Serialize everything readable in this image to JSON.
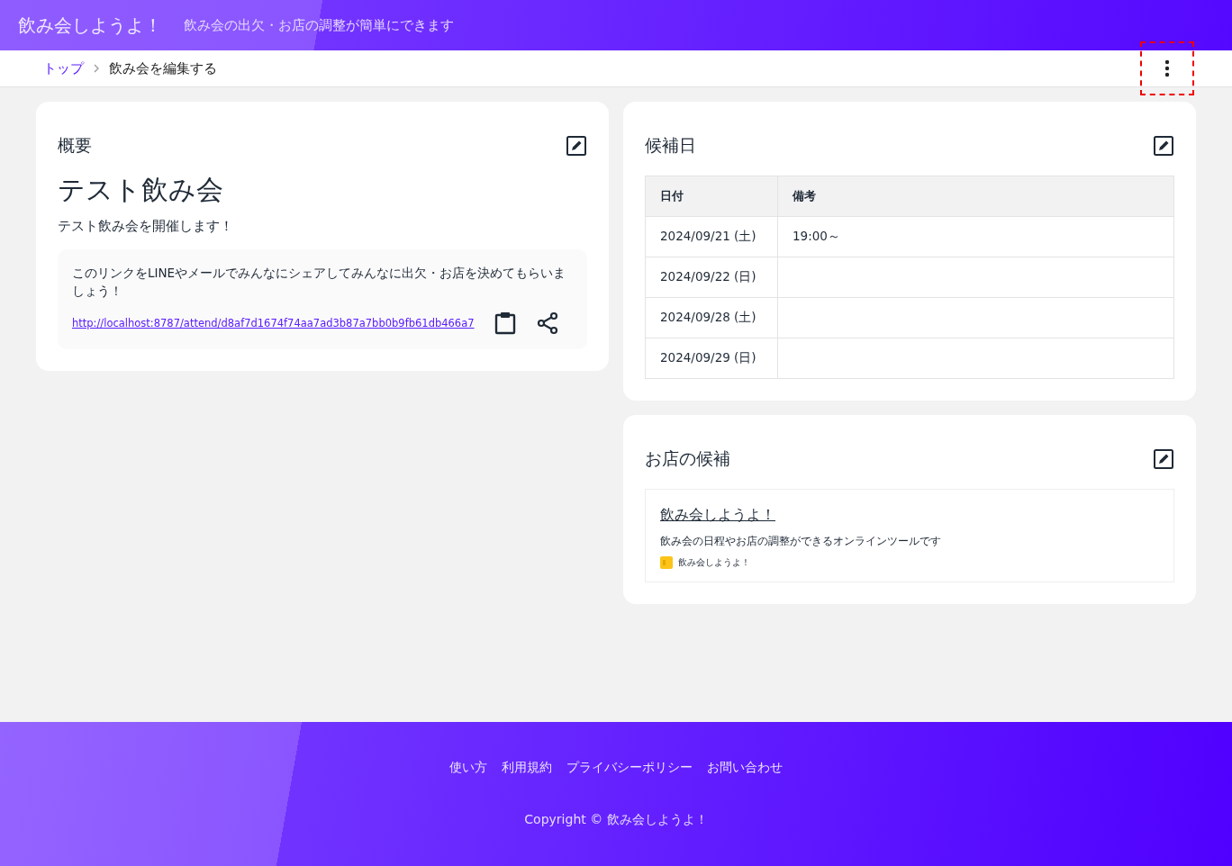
{
  "header": {
    "title": "飲み会しようよ！",
    "tagline": "飲み会の出欠・お店の調整が簡単にできます"
  },
  "breadcrumb": [
    {
      "label": "トップ",
      "link": true
    },
    {
      "label": "飲み会を編集する",
      "link": false
    }
  ],
  "menu_button": {
    "highlighted": true
  },
  "overview": {
    "heading": "概要",
    "event_title": "テスト飲み会",
    "description": "テスト飲み会を開催します！",
    "share_note": "このリンクをLINEやメールでみんなにシェアしてみんなに出欠・お店を決めてもらいましょう！",
    "share_url": "http://localhost:8787/attend/d8af7d1674f74aa7ad3b87a7bb0b9fb61db466a7"
  },
  "candidate_dates": {
    "heading": "候補日",
    "columns": [
      "日付",
      "備考"
    ],
    "rows": [
      {
        "date": "2024/09/21 (土)",
        "note": "19:00～"
      },
      {
        "date": "2024/09/22 (日)"
      },
      {
        "date": "2024/09/28 (土)"
      },
      {
        "date": "2024/09/29 (日)"
      }
    ]
  },
  "shops": {
    "heading": "お店の候補",
    "items": [
      {
        "title": "飲み会しようよ！",
        "description": "飲み会の日程やお店の調整ができるオンラインツールです",
        "site": "飲み会しようよ！"
      }
    ]
  },
  "footer": {
    "links": [
      "使い方",
      "利用規約",
      "プライバシーポリシー",
      "お問い合わせ"
    ],
    "copyright": "Copyright © 飲み会しようよ！"
  }
}
